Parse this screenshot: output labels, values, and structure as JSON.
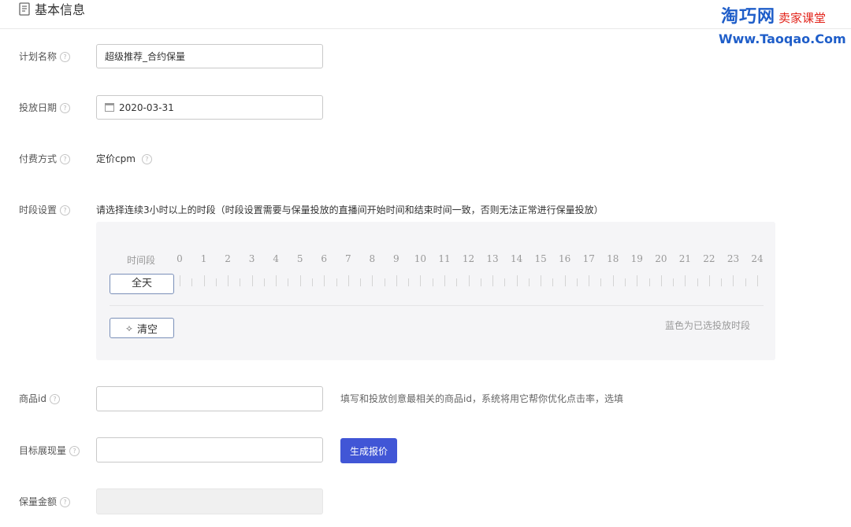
{
  "section": {
    "title": "基本信息",
    "icon": "document-icon"
  },
  "watermark": {
    "brand": "淘巧网",
    "tag": "卖家课堂",
    "url": "Www.Taoqao.Com",
    "brand_color": "#1f5ec9",
    "tag_color": "#e2231a"
  },
  "help_icon": "?",
  "fields": {
    "plan_name": {
      "label": "计划名称",
      "value": "超级推荐_合约保量"
    },
    "date": {
      "label": "投放日期",
      "value": "2020-03-31"
    },
    "payment": {
      "label": "付费方式",
      "value": "定价cpm"
    },
    "time_setting": {
      "label": "时段设置",
      "hint": "请选择连续3小时以上的时段（时段设置需要与保量投放的直播间开始时间和结束时间一致，否则无法正常进行保量投放）",
      "grid_label": "时间段",
      "hours": [
        "0",
        "1",
        "2",
        "3",
        "4",
        "5",
        "6",
        "7",
        "8",
        "9",
        "10",
        "11",
        "12",
        "13",
        "14",
        "15",
        "16",
        "17",
        "18",
        "19",
        "20",
        "21",
        "22",
        "23",
        "24"
      ],
      "all_day_label": "全天",
      "clear_label": "清空",
      "legend": "蓝色为已选投放时段"
    },
    "product_id": {
      "label": "商品id",
      "value": "",
      "hint": "填写和投放创意最相关的商品id，系统将用它帮你优化点击率，选填"
    },
    "target_impressions": {
      "label": "目标展现量",
      "value": "",
      "button_label": "生成报价"
    },
    "guarantee_amount": {
      "label": "保量金额",
      "value": ""
    }
  },
  "colors": {
    "primary_button": "#4156d6",
    "timebox_bg": "#f5f5f7"
  }
}
